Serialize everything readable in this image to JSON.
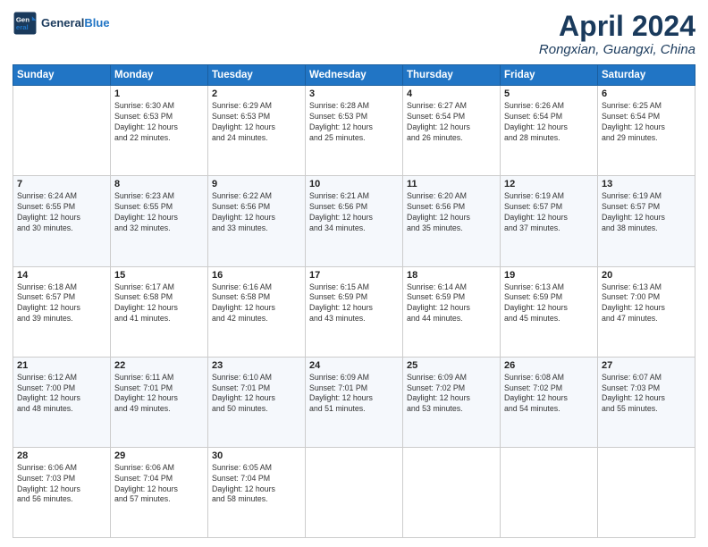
{
  "header": {
    "logo_line1": "General",
    "logo_line2": "Blue",
    "month": "April 2024",
    "location": "Rongxian, Guangxi, China"
  },
  "weekdays": [
    "Sunday",
    "Monday",
    "Tuesday",
    "Wednesday",
    "Thursday",
    "Friday",
    "Saturday"
  ],
  "weeks": [
    [
      {
        "day": "",
        "info": ""
      },
      {
        "day": "1",
        "info": "Sunrise: 6:30 AM\nSunset: 6:53 PM\nDaylight: 12 hours\nand 22 minutes."
      },
      {
        "day": "2",
        "info": "Sunrise: 6:29 AM\nSunset: 6:53 PM\nDaylight: 12 hours\nand 24 minutes."
      },
      {
        "day": "3",
        "info": "Sunrise: 6:28 AM\nSunset: 6:53 PM\nDaylight: 12 hours\nand 25 minutes."
      },
      {
        "day": "4",
        "info": "Sunrise: 6:27 AM\nSunset: 6:54 PM\nDaylight: 12 hours\nand 26 minutes."
      },
      {
        "day": "5",
        "info": "Sunrise: 6:26 AM\nSunset: 6:54 PM\nDaylight: 12 hours\nand 28 minutes."
      },
      {
        "day": "6",
        "info": "Sunrise: 6:25 AM\nSunset: 6:54 PM\nDaylight: 12 hours\nand 29 minutes."
      }
    ],
    [
      {
        "day": "7",
        "info": "Sunrise: 6:24 AM\nSunset: 6:55 PM\nDaylight: 12 hours\nand 30 minutes."
      },
      {
        "day": "8",
        "info": "Sunrise: 6:23 AM\nSunset: 6:55 PM\nDaylight: 12 hours\nand 32 minutes."
      },
      {
        "day": "9",
        "info": "Sunrise: 6:22 AM\nSunset: 6:56 PM\nDaylight: 12 hours\nand 33 minutes."
      },
      {
        "day": "10",
        "info": "Sunrise: 6:21 AM\nSunset: 6:56 PM\nDaylight: 12 hours\nand 34 minutes."
      },
      {
        "day": "11",
        "info": "Sunrise: 6:20 AM\nSunset: 6:56 PM\nDaylight: 12 hours\nand 35 minutes."
      },
      {
        "day": "12",
        "info": "Sunrise: 6:19 AM\nSunset: 6:57 PM\nDaylight: 12 hours\nand 37 minutes."
      },
      {
        "day": "13",
        "info": "Sunrise: 6:19 AM\nSunset: 6:57 PM\nDaylight: 12 hours\nand 38 minutes."
      }
    ],
    [
      {
        "day": "14",
        "info": "Sunrise: 6:18 AM\nSunset: 6:57 PM\nDaylight: 12 hours\nand 39 minutes."
      },
      {
        "day": "15",
        "info": "Sunrise: 6:17 AM\nSunset: 6:58 PM\nDaylight: 12 hours\nand 41 minutes."
      },
      {
        "day": "16",
        "info": "Sunrise: 6:16 AM\nSunset: 6:58 PM\nDaylight: 12 hours\nand 42 minutes."
      },
      {
        "day": "17",
        "info": "Sunrise: 6:15 AM\nSunset: 6:59 PM\nDaylight: 12 hours\nand 43 minutes."
      },
      {
        "day": "18",
        "info": "Sunrise: 6:14 AM\nSunset: 6:59 PM\nDaylight: 12 hours\nand 44 minutes."
      },
      {
        "day": "19",
        "info": "Sunrise: 6:13 AM\nSunset: 6:59 PM\nDaylight: 12 hours\nand 45 minutes."
      },
      {
        "day": "20",
        "info": "Sunrise: 6:13 AM\nSunset: 7:00 PM\nDaylight: 12 hours\nand 47 minutes."
      }
    ],
    [
      {
        "day": "21",
        "info": "Sunrise: 6:12 AM\nSunset: 7:00 PM\nDaylight: 12 hours\nand 48 minutes."
      },
      {
        "day": "22",
        "info": "Sunrise: 6:11 AM\nSunset: 7:01 PM\nDaylight: 12 hours\nand 49 minutes."
      },
      {
        "day": "23",
        "info": "Sunrise: 6:10 AM\nSunset: 7:01 PM\nDaylight: 12 hours\nand 50 minutes."
      },
      {
        "day": "24",
        "info": "Sunrise: 6:09 AM\nSunset: 7:01 PM\nDaylight: 12 hours\nand 51 minutes."
      },
      {
        "day": "25",
        "info": "Sunrise: 6:09 AM\nSunset: 7:02 PM\nDaylight: 12 hours\nand 53 minutes."
      },
      {
        "day": "26",
        "info": "Sunrise: 6:08 AM\nSunset: 7:02 PM\nDaylight: 12 hours\nand 54 minutes."
      },
      {
        "day": "27",
        "info": "Sunrise: 6:07 AM\nSunset: 7:03 PM\nDaylight: 12 hours\nand 55 minutes."
      }
    ],
    [
      {
        "day": "28",
        "info": "Sunrise: 6:06 AM\nSunset: 7:03 PM\nDaylight: 12 hours\nand 56 minutes."
      },
      {
        "day": "29",
        "info": "Sunrise: 6:06 AM\nSunset: 7:04 PM\nDaylight: 12 hours\nand 57 minutes."
      },
      {
        "day": "30",
        "info": "Sunrise: 6:05 AM\nSunset: 7:04 PM\nDaylight: 12 hours\nand 58 minutes."
      },
      {
        "day": "",
        "info": ""
      },
      {
        "day": "",
        "info": ""
      },
      {
        "day": "",
        "info": ""
      },
      {
        "day": "",
        "info": ""
      }
    ]
  ]
}
